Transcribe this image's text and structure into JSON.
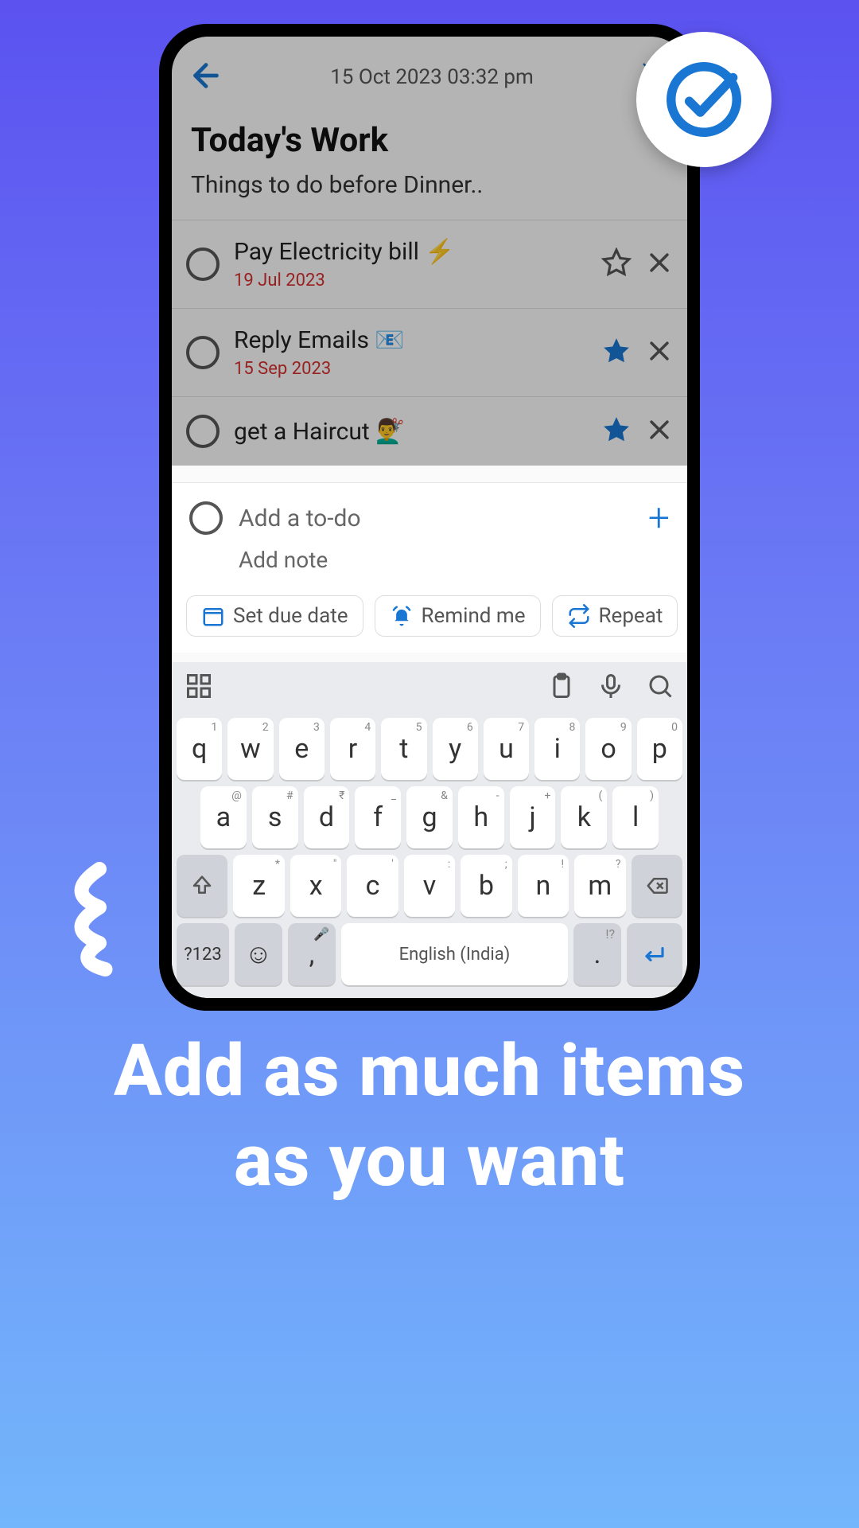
{
  "topbar": {
    "datetime": "15 Oct 2023 03:32 pm"
  },
  "header": {
    "title": "Today's Work",
    "subtitle": "Things to do before Dinner.."
  },
  "tasks": [
    {
      "text": "Pay Electricity bill ⚡",
      "date": "19 Jul 2023",
      "starred": false
    },
    {
      "text": "Reply Emails 📧",
      "date": "15 Sep 2023",
      "starred": true
    },
    {
      "text": "get a Haircut 💇‍♂️",
      "date": "",
      "starred": true
    }
  ],
  "input": {
    "todo_placeholder": "Add a to-do",
    "note_placeholder": "Add note",
    "chips": {
      "due": "Set due date",
      "remind": "Remind me",
      "repeat": "Repeat"
    }
  },
  "keyboard": {
    "row1": [
      "q",
      "w",
      "e",
      "r",
      "t",
      "y",
      "u",
      "i",
      "o",
      "p"
    ],
    "hints1": [
      "1",
      "2",
      "3",
      "4",
      "5",
      "6",
      "7",
      "8",
      "9",
      "0"
    ],
    "row2": [
      "a",
      "s",
      "d",
      "f",
      "g",
      "h",
      "j",
      "k",
      "l"
    ],
    "hints2": [
      "@",
      "#",
      "₹",
      "_",
      "&",
      "-",
      "+",
      "(",
      ")"
    ],
    "row3": [
      "z",
      "x",
      "c",
      "v",
      "b",
      "n",
      "m"
    ],
    "hints3": [
      "*",
      "\"",
      "'",
      ":",
      ";",
      "!",
      "?"
    ],
    "sym": "?123",
    "space": "English (India)"
  },
  "caption": {
    "line1": "Add as much items",
    "line2": "as you want"
  }
}
